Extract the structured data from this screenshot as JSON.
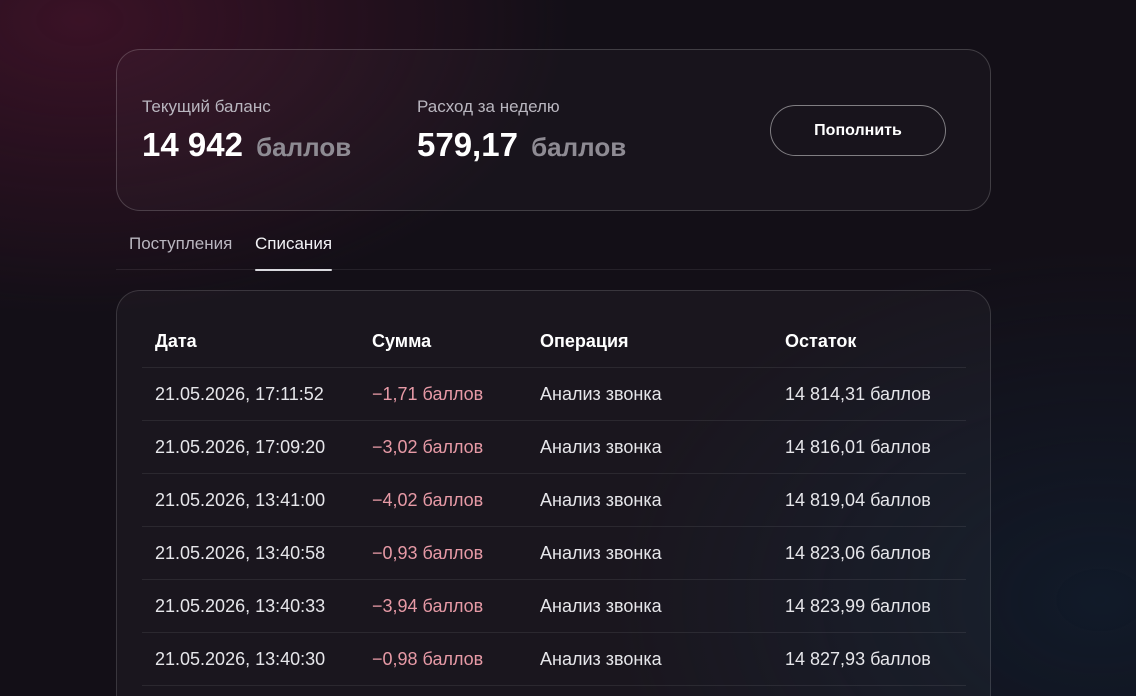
{
  "balance": {
    "current_label": "Текущий баланс",
    "current_value": "14 942",
    "current_unit": "баллов",
    "weekly_label": "Расход за неделю",
    "weekly_value": "579,17",
    "weekly_unit": "баллов",
    "topup_label": "Пополнить"
  },
  "tabs": [
    {
      "label": "Поступления",
      "active": false
    },
    {
      "label": "Списания",
      "active": true
    }
  ],
  "table": {
    "columns": [
      "Дата",
      "Сумма",
      "Операция",
      "Остаток"
    ],
    "rows": [
      {
        "date": "21.05.2026, 17:11:52",
        "sum": "−1,71 баллов",
        "operation": "Анализ звонка",
        "rest": "14 814,31 баллов"
      },
      {
        "date": "21.05.2026, 17:09:20",
        "sum": "−3,02 баллов",
        "operation": "Анализ звонка",
        "rest": "14 816,01 баллов"
      },
      {
        "date": "21.05.2026, 13:41:00",
        "sum": "−4,02 баллов",
        "operation": "Анализ звонка",
        "rest": "14 819,04 баллов"
      },
      {
        "date": "21.05.2026, 13:40:58",
        "sum": "−0,93 баллов",
        "operation": "Анализ звонка",
        "rest": "14 823,06 баллов"
      },
      {
        "date": "21.05.2026, 13:40:33",
        "sum": "−3,94 баллов",
        "operation": "Анализ звонка",
        "rest": "14 823,99 баллов"
      },
      {
        "date": "21.05.2026, 13:40:30",
        "sum": "−0,98 баллов",
        "operation": "Анализ звонка",
        "rest": "14 827,93 баллов"
      }
    ]
  },
  "colors": {
    "negative_amount": "#e79aa6",
    "background": "#130f17"
  }
}
